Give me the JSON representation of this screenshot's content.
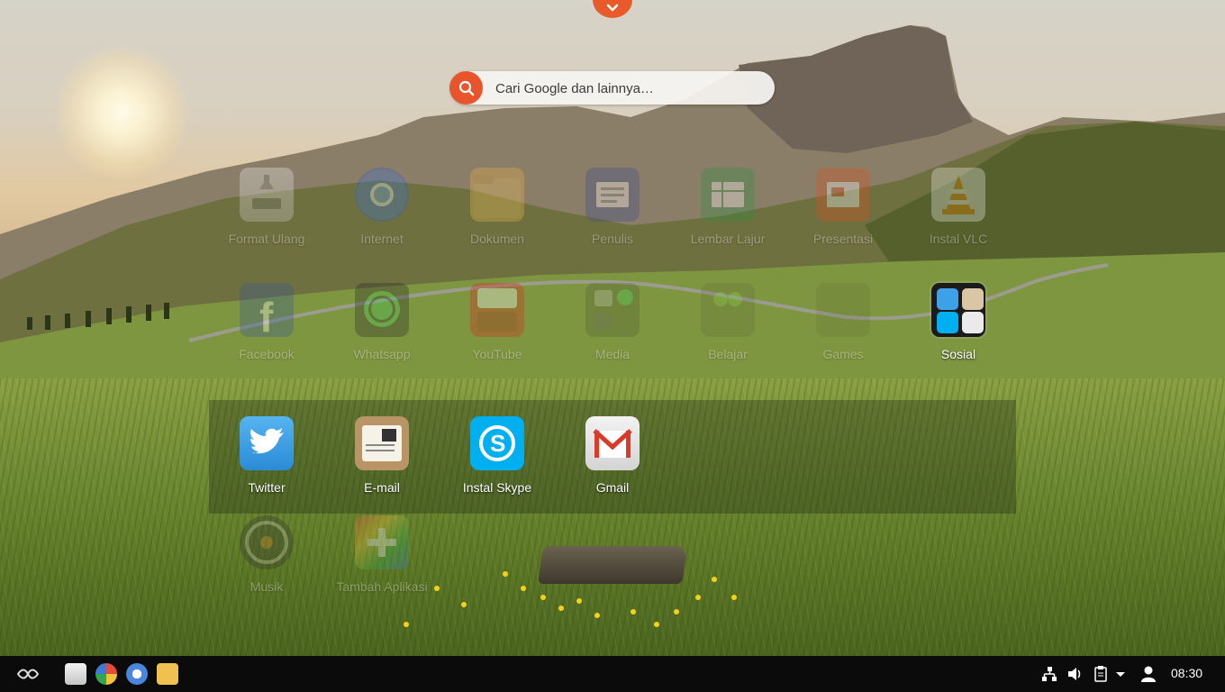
{
  "search": {
    "placeholder": "Cari Google dan lainnya…"
  },
  "apps_row1": [
    "Format Ulang",
    "Internet",
    "Dokumen",
    "Penulis",
    "Lembar Lajur",
    "Presentasi",
    "Instal VLC"
  ],
  "apps_row2": [
    "Facebook",
    "Whatsapp",
    "YouTube",
    "Media",
    "Belajar",
    "Games",
    "Sosial"
  ],
  "folder_apps": [
    "Twitter",
    "E-mail",
    "Instal Skype",
    "Gmail"
  ],
  "apps_row4": [
    "Musik",
    "Tambah Aplikasi"
  ],
  "taskbar": {
    "clock": "08:30"
  },
  "icons": {
    "format": "install-disk-icon",
    "internet": "chromium-icon",
    "dokumen": "folder-icon",
    "penulis": "writer-icon",
    "lembar": "spreadsheet-icon",
    "presentasi": "presentation-icon",
    "vlc": "vlc-cone-icon"
  },
  "colors": {
    "accent": "#e8542b",
    "taskbar": "#0b0b0b",
    "twitter": "#3ea0e7",
    "skype": "#00aff0",
    "gmail": "#d93a2c"
  }
}
